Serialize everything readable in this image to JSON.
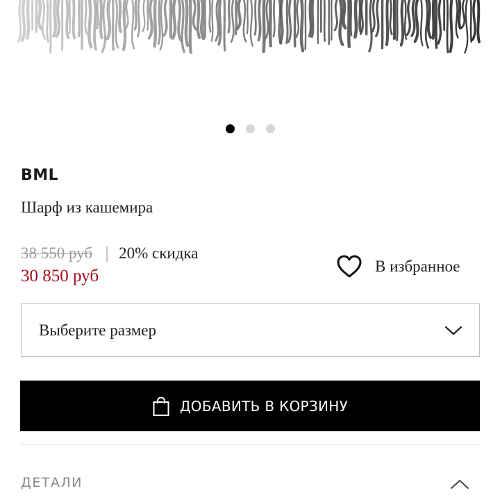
{
  "gallery": {
    "slides": 3,
    "active_index": 0
  },
  "product": {
    "brand": "BML",
    "name": "Шарф из кашемира",
    "old_price": "38 550 руб",
    "separator": "|",
    "discount": "20% скидка",
    "price": "30 850 руб",
    "price_color": "#a30d1a"
  },
  "favorites": {
    "label": "В избранное",
    "icon": "heart-outline-icon"
  },
  "size_select": {
    "placeholder": "Выберите размер",
    "icon": "chevron-down-icon"
  },
  "cart_button": {
    "label": "ДОБАВИТЬ В КОРЗИНУ",
    "icon": "shopping-bag-icon"
  },
  "details": {
    "label": "ДЕТАЛИ",
    "icon": "chevron-up-icon"
  }
}
